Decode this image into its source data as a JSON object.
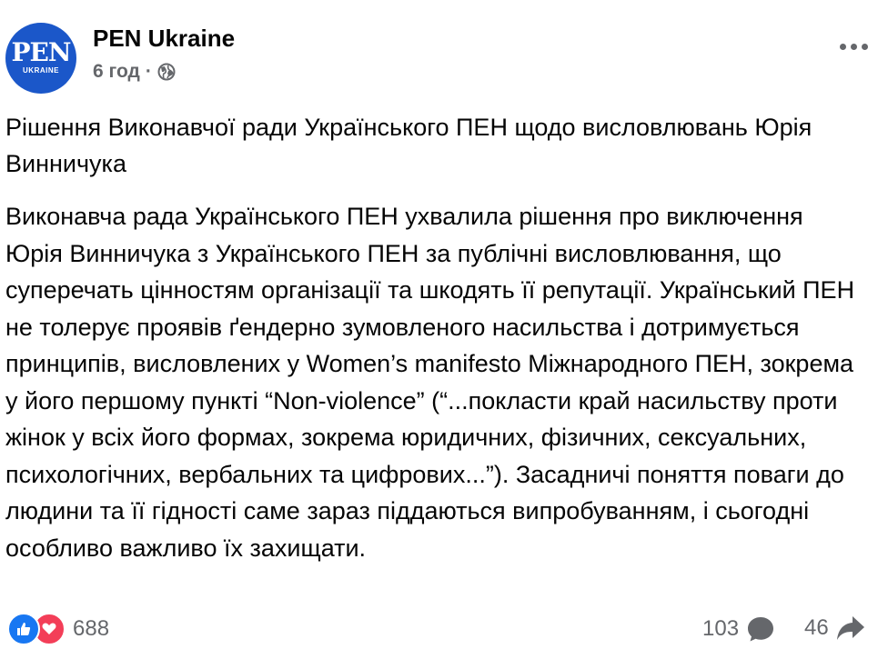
{
  "header": {
    "page_name": "PEN Ukraine",
    "time": "6 год",
    "dot": "·",
    "avatar_logo": "PEN",
    "avatar_sub": "UKRAINE",
    "privacy_icon": "globe-icon",
    "more_icon": "more-options-icon"
  },
  "post": {
    "title": "Рішення Виконавчої ради Українського ПЕН щодо висловлювань Юрія Винничука",
    "body": "Виконавча рада Українського ПЕН ухвалила рішення про виключення Юрія Винничука з Українського ПЕН за публічні висловлювання, що суперечать цінностям організації та шкодять її репутації. Український ПЕН не толерує проявів ґендерно зумовленого насильства і дотримується принципів, висловлених у Women’s manifesto Міжнародного ПЕН, зокрема у його першому пункті “Non-violence” (“...покласти край насильству проти жінок у всіх його формах, зокрема юридичних, фізичних, сексуальних, психологічних, вербальних та цифрових...”). Засадничі поняття поваги до людини та її гідності саме зараз піддаються випробуванням, і сьогодні особливо важливо їх захищати."
  },
  "footer": {
    "reactions_count": "688",
    "comments_count": "103",
    "shares_count": "46"
  },
  "colors": {
    "brand_blue": "#1b57c9",
    "like_blue": "#1877f2",
    "love_red": "#f33e58",
    "secondary_text": "#65676b"
  }
}
